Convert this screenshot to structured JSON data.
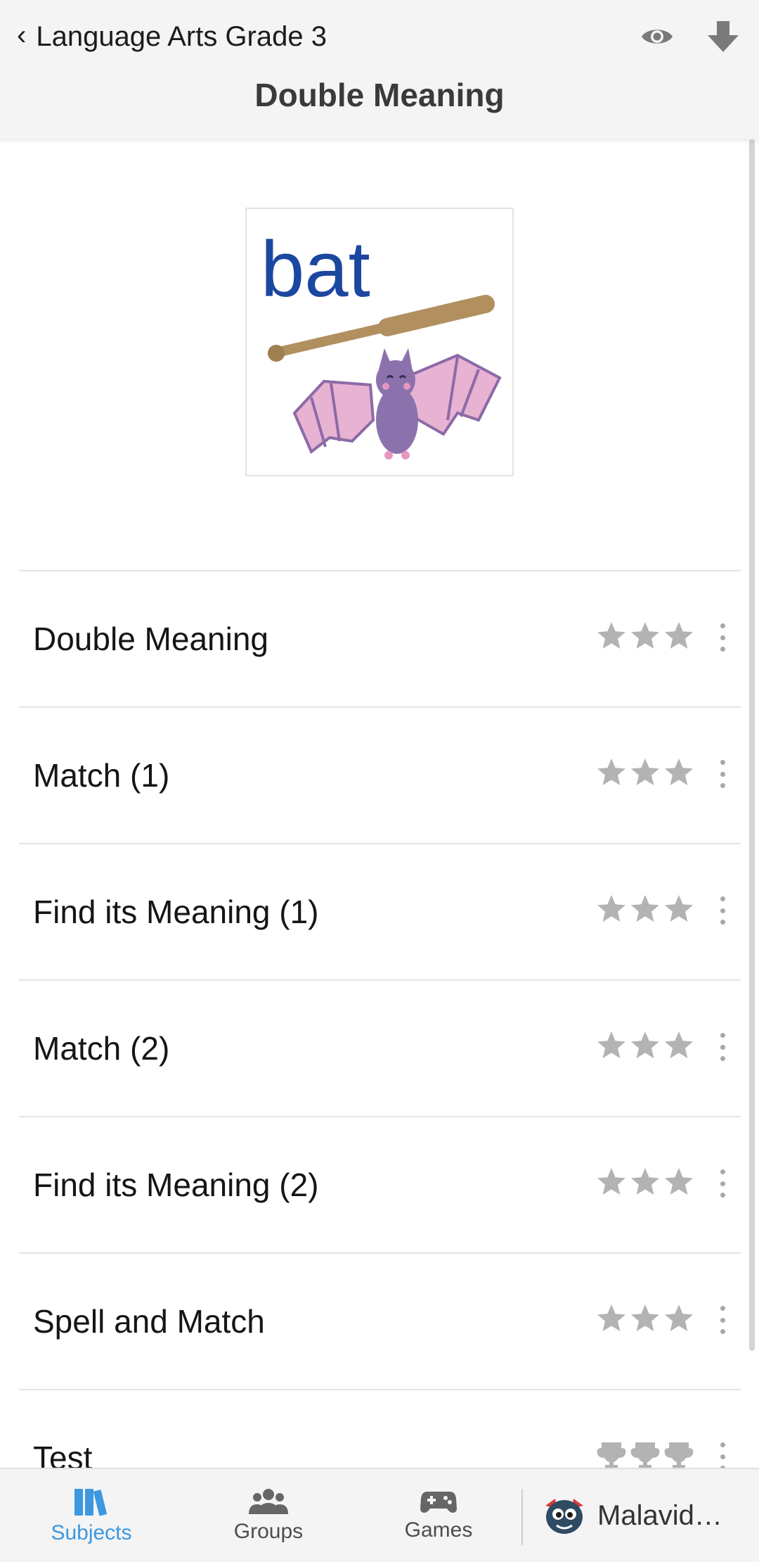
{
  "header": {
    "back_label": "Language Arts Grade 3",
    "title": "Double Meaning",
    "icons": [
      "eye-icon",
      "download-icon"
    ]
  },
  "thumbnail": {
    "word": "bat",
    "word_color": "#1c47a0"
  },
  "lessons": [
    {
      "label": "Double Meaning",
      "rating_icon": "star-icon",
      "rating": 0,
      "max": 3
    },
    {
      "label": "Match (1)",
      "rating_icon": "star-icon",
      "rating": 0,
      "max": 3
    },
    {
      "label": "Find its Meaning (1)",
      "rating_icon": "star-icon",
      "rating": 0,
      "max": 3
    },
    {
      "label": "Match (2)",
      "rating_icon": "star-icon",
      "rating": 0,
      "max": 3
    },
    {
      "label": "Find its Meaning (2)",
      "rating_icon": "star-icon",
      "rating": 0,
      "max": 3
    },
    {
      "label": "Spell and Match",
      "rating_icon": "star-icon",
      "rating": 0,
      "max": 3
    },
    {
      "label": "Test",
      "rating_icon": "trophy-icon",
      "rating": 0,
      "max": 3
    }
  ],
  "bottom_nav": {
    "subjects": "Subjects",
    "groups": "Groups",
    "games": "Games",
    "profile_name": "Malavid…",
    "active": "subjects"
  },
  "colors": {
    "accent": "#3d98e0",
    "rating_inactive": "#b3b3b3",
    "header_bg": "#f4f4f4"
  }
}
